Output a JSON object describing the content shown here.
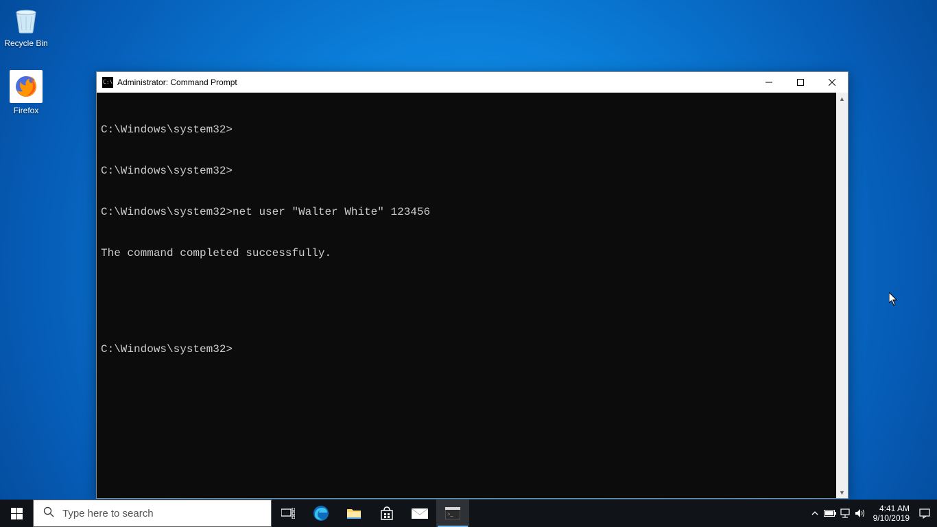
{
  "desktop": {
    "icons": {
      "recycle_bin": "Recycle Bin",
      "firefox": "Firefox"
    }
  },
  "window": {
    "title": "Administrator: Command Prompt"
  },
  "terminal": {
    "lines": [
      "C:\\Windows\\system32>",
      "C:\\Windows\\system32>",
      "C:\\Windows\\system32>net user \"Walter White\" 123456",
      "The command completed successfully.",
      "",
      "",
      "C:\\Windows\\system32>"
    ]
  },
  "taskbar": {
    "search_placeholder": "Type here to search",
    "time": "4:41 AM",
    "date": "9/10/2019"
  }
}
